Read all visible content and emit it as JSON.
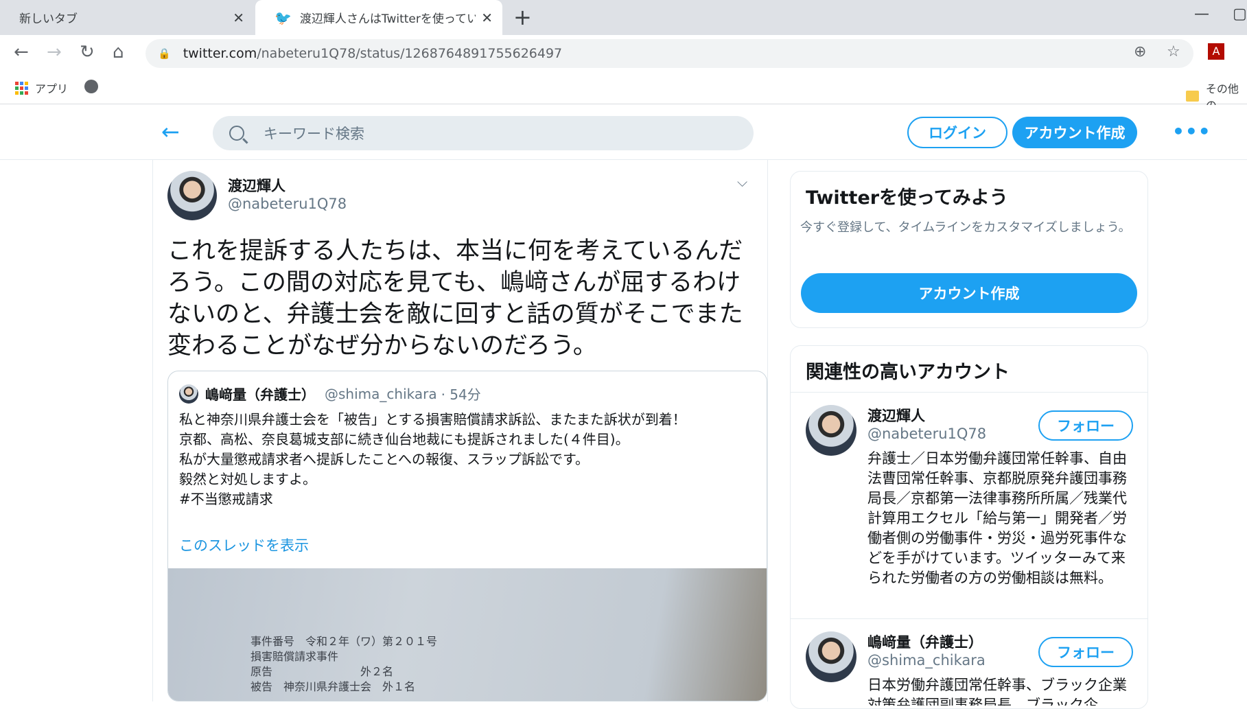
{
  "browser": {
    "tabs": [
      {
        "title": "新しいタブ",
        "active": false
      },
      {
        "title": "渡辺輝人さんはTwitterを使っています",
        "active": true
      }
    ],
    "url_host": "twitter.com",
    "url_path": "/nabeteru1Q78/status/1268764891755626497",
    "bookmarks": {
      "apps_label": "アプリ",
      "other_label": "その他の"
    }
  },
  "twitter_header": {
    "search_placeholder": "キーワード検索",
    "login_label": "ログイン",
    "signup_label": "アカウント作成",
    "more_icon": "•••"
  },
  "tweet": {
    "author_name": "渡辺輝人",
    "author_handle": "@nabeteru1Q78",
    "text": "これを提訴する人たちは、本当に何を考えているんだろう。この間の対応を見ても、嶋﨑さんが屈するわけないのと、弁護士会を敵に回すと話の質がそこでまた変わることがなぜ分からないのだろう。",
    "quoted": {
      "author_name": "嶋﨑量（弁護士）",
      "author_handle": "@shima_chikara",
      "time": "· 54分",
      "lines": [
        "私と神奈川県弁護士会を「被告」とする損害賠償請求訴訟、またまた訴状が到着！",
        "京都、高松、奈良葛城支部に続き仙台地裁にも提訴されました(４件目)。",
        "私が大量懲戒請求者へ提訴したことへの報復、スラップ訴訟です。",
        "毅然と対処しますよ。",
        "#不当懲戒請求"
      ],
      "thread_link": "このスレッドを表示",
      "photo_lines": [
        "事件番号　令和２年（ワ）第２０１号",
        "損害賠償請求事件",
        "原告　　　　　　　　外２名",
        "被告　神奈川県弁護士会　外１名"
      ]
    }
  },
  "sidebar": {
    "cta": {
      "title": "Twitterを使ってみよう",
      "desc": "今すぐ登録して、タイムラインをカスタマイズしましょう。",
      "button": "アカウント作成"
    },
    "related": {
      "title": "関連性の高いアカウント",
      "follow_label": "フォロー",
      "accounts": [
        {
          "name": "渡辺輝人",
          "handle": "@nabeteru1Q78",
          "bio": "弁護士／日本労働弁護団常任幹事、自由法曹団常任幹事、京都脱原発弁護団事務局長／京都第一法律事務所所属／残業代計算用エクセル「給与第一」開発者／労働者側の労働事件・労災・過労死事件などを手がけています。ツイッターみて来られた労働者の方の労働相談は無料。"
        },
        {
          "name": "嶋﨑量（弁護士）",
          "handle": "@shima_chikara",
          "bio": "日本労働弁護団常任幹事、ブラック企業対策弁護団副事務局長、ブラック企"
        }
      ]
    }
  }
}
